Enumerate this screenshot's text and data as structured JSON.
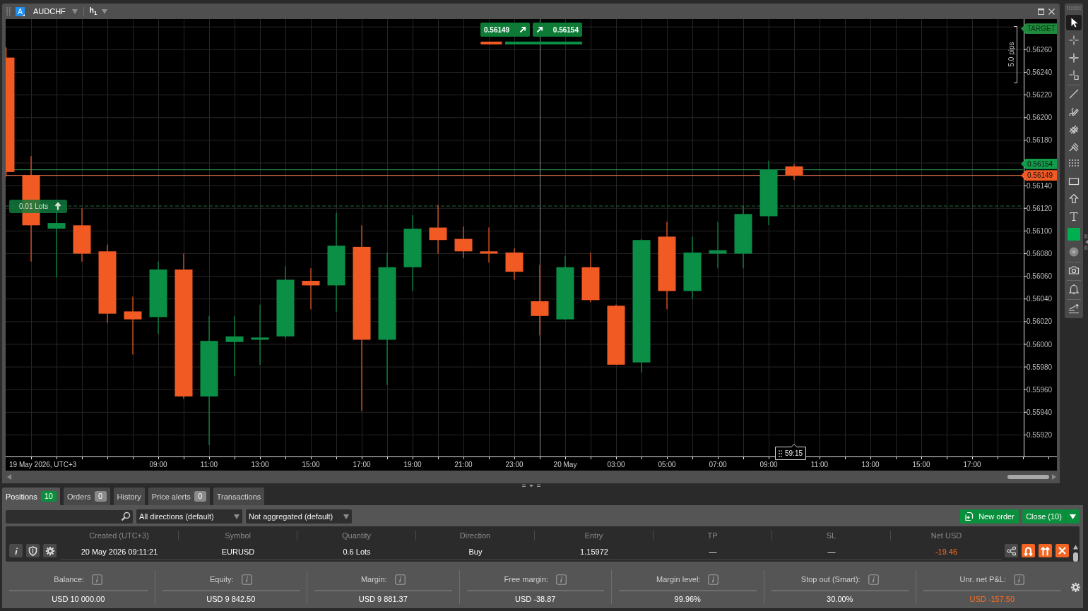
{
  "chart_window": {
    "symbol_badge": "A",
    "symbol": "AUDCHF",
    "timeframe": "h$_{1}$"
  },
  "chart": {
    "quote": {
      "sell": "0.56149",
      "buy": "0.56154",
      "sentiment": {
        "level": 0.79
      }
    },
    "range_marker": "5.0 pips",
    "countdown": "59:15",
    "position_tag": "0.01 Lots",
    "price_tags": [
      {
        "kind": "target",
        "label": "TARGET"
      },
      {
        "kind": "ask",
        "label": "0.56154"
      },
      {
        "kind": "bid",
        "label": "0.56149"
      }
    ],
    "price_labels": [
      "0.56260",
      "0.56240",
      "0.56220",
      "0.56200",
      "0.56180",
      "0.56140",
      "0.56120",
      "0.56100",
      "0.56080",
      "0.56060",
      "0.56040",
      "0.56020",
      "0.56000",
      "0.55980",
      "0.55960",
      "0.55940",
      "0.55920"
    ],
    "time_labels": [
      "19 May 2026, UTC+3",
      "09:00",
      "11:00",
      "13:00",
      "15:00",
      "17:00",
      "19:00",
      "21:00",
      "23:00",
      "20 May",
      "03:00",
      "05:00",
      "07:00",
      "09:00",
      "11:00",
      "13:00",
      "15:00",
      "17:00"
    ]
  },
  "toolbar": {
    "groups": [
      [
        {
          "kind": "pointer",
          "selected": true
        },
        {
          "kind": "crosshair",
          "selected": false
        },
        {
          "kind": "magnet_crosshair",
          "selected": false
        },
        {
          "kind": "measure",
          "selected": false
        }
      ],
      [
        {
          "kind": "line",
          "selected": false
        },
        {
          "kind": "brush",
          "selected": false
        },
        {
          "kind": "fibonacci",
          "selected": false
        },
        {
          "kind": "pitchfork",
          "selected": false
        },
        {
          "kind": "grid",
          "selected": false
        },
        {
          "kind": "rectangle",
          "selected": false
        },
        {
          "kind": "arrow",
          "selected": false
        },
        {
          "kind": "text",
          "selected": false
        },
        {
          "kind": "swatch",
          "selected": false,
          "color": "#00b050"
        },
        {
          "kind": "circle",
          "selected": false
        }
      ],
      [
        {
          "kind": "camera",
          "selected": false
        }
      ],
      [
        {
          "kind": "bell",
          "selected": false
        }
      ],
      [
        {
          "kind": "levels",
          "selected": false
        }
      ]
    ]
  },
  "bottom_panel": {
    "tabs": [
      {
        "label": "Positions",
        "count": "10",
        "selected": true
      },
      {
        "label": "Orders",
        "count": "0",
        "selected": false
      },
      {
        "label": "History",
        "selected": false
      },
      {
        "label": "Price alerts",
        "count": "0",
        "selected": false
      },
      {
        "label": "Transactions",
        "selected": false
      }
    ],
    "filters": [
      "All directions (default)",
      "Not aggregated (default)"
    ],
    "buttons": {
      "new_order": "New order",
      "close": "Close (10)"
    },
    "table": {
      "columns": [
        "Created (UTC+3)",
        "Symbol",
        "Quantity",
        "Direction",
        "Entry",
        "TP",
        "SL",
        "Net USD"
      ],
      "rows": [
        {
          "cells": [
            "20 May 2026 09:11:21",
            "EURUSD",
            "0.6 Lots",
            "Buy",
            "1.15972",
            "—",
            "—"
          ],
          "net_usd": {
            "text": "-19.46",
            "color": "#ff6d1f"
          }
        }
      ]
    },
    "summary": [
      {
        "label": "Balance:",
        "value": "USD 10 000.00"
      },
      {
        "label": "Equity:",
        "value": "USD 9 842.50"
      },
      {
        "label": "Margin:",
        "value": "USD 9 881.37"
      },
      {
        "label": "Free margin:",
        "value": "USD -38.87"
      },
      {
        "label": "Margin level:",
        "value": "99.96%"
      },
      {
        "label": "Stop out (Smart):",
        "value": "30.00%"
      },
      {
        "label": "Unr. net P&L:",
        "value": "USD -157.50",
        "color": "#ff6d1f"
      }
    ]
  }
}
